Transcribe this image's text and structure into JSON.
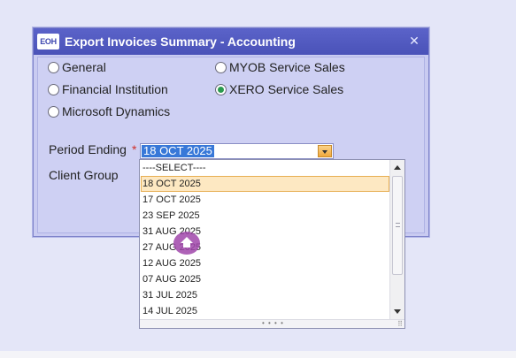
{
  "dialog": {
    "logo_text": "EOH",
    "title": "Export Invoices Summary - Accounting",
    "close_symbol": "✕"
  },
  "options": [
    {
      "label": "General",
      "selected": false
    },
    {
      "label": "MYOB Service Sales",
      "selected": false
    },
    {
      "label": "Financial Institution",
      "selected": false
    },
    {
      "label": "XERO Service Sales",
      "selected": true
    },
    {
      "label": "Microsoft Dynamics",
      "selected": false
    }
  ],
  "period": {
    "label": "Period Ending",
    "required_mark": "*",
    "value": "18 OCT 2025",
    "options": [
      "----SELECT----",
      "18 OCT 2025",
      "17 OCT 2025",
      "23 SEP 2025",
      "31 AUG 2025",
      "27 AUG 2025",
      "12 AUG 2025",
      "07 AUG 2025",
      "31 JUL 2025",
      "14 JUL 2025"
    ],
    "highlighted": "18 OCT 2025"
  },
  "client_group": {
    "label": "Client Group"
  },
  "dropdown": {
    "resize_dots": "• • • •",
    "grip": "⠿"
  },
  "icons": {
    "cursor": "home-cursor-icon"
  },
  "colors": {
    "title_bar": "#4a52b8",
    "selection": "#3878d8",
    "highlight_bg": "#fde8c2",
    "radio_on": "#2a9a4e",
    "required": "#d0302a"
  }
}
